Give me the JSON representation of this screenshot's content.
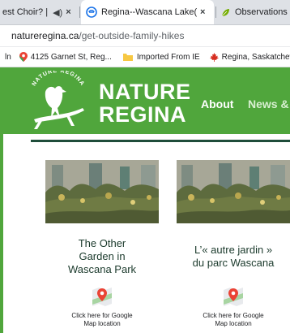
{
  "browser": {
    "tabs": [
      {
        "label": "est Choir? |",
        "has_audio": true
      },
      {
        "label": "Regina--Wascana Lake(between …",
        "active": true
      },
      {
        "label": "Observations · iNa",
        "active": false
      }
    ],
    "tab_close_glyph": "×",
    "audio_glyph": "◀)",
    "url_host": "natureregina.ca",
    "url_path": "/get-outside-family-hikes",
    "bookmarks": [
      {
        "label": "ln",
        "icon": "none"
      },
      {
        "label": "4125 Garnet St, Reg...",
        "icon": "map-pin-icon"
      },
      {
        "label": "Imported From IE",
        "icon": "folder-icon"
      },
      {
        "label": "Regina, Saskatchew...",
        "icon": "maple-leaf-icon"
      }
    ]
  },
  "site": {
    "logo_text": "NATURE REGINA",
    "brand_line1": "NATURE",
    "brand_line2": "REGINA",
    "nav": [
      "About",
      "News & I"
    ],
    "header_color": "#50a63c",
    "rule_color": "#1f4d3a"
  },
  "cards": [
    {
      "title": "The Other Garden in Wascana Park",
      "title_lines": [
        "The Other",
        "Garden in",
        "Wascana Park"
      ],
      "map_link_lines": [
        "Click here for Google",
        "Map location"
      ]
    },
    {
      "title": "L’« autre jardin » du parc Wascana",
      "title_lines": [
        "L’« autre jardin »",
        "du parc Wascana"
      ],
      "map_link_lines": [
        "Click here for Google",
        "Map location"
      ]
    }
  ]
}
